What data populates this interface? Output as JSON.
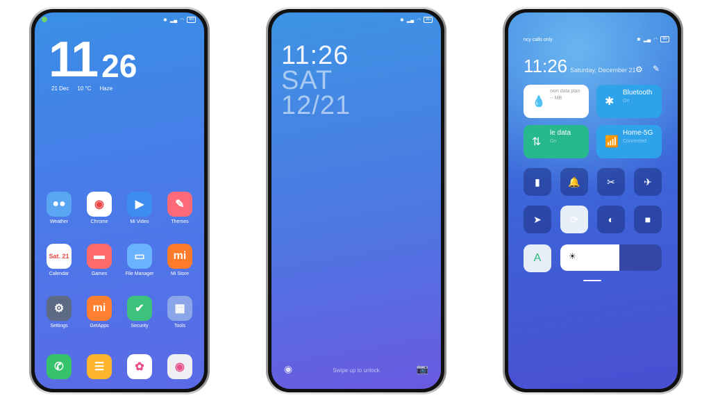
{
  "status": {
    "battery": "80"
  },
  "home": {
    "hour": "11",
    "minute": "26",
    "date": "21 Dec",
    "temp": "10 °C",
    "weather": "Haze",
    "apps": [
      [
        {
          "label": "Weather",
          "glyph": "●●",
          "bg": "#5aa6f3"
        },
        {
          "label": "Chrome",
          "glyph": "◉",
          "bg": "#ffffff"
        },
        {
          "label": "Mi Video",
          "glyph": "▶",
          "bg": "#3d8cf0"
        },
        {
          "label": "Themes",
          "glyph": "✎",
          "bg": "#ff6a7a"
        }
      ],
      [
        {
          "label": "Calendar",
          "glyph": "Sat. 21",
          "bg": "#ffffff"
        },
        {
          "label": "Games",
          "glyph": "▬",
          "bg": "#ff6b6b"
        },
        {
          "label": "File Manager",
          "glyph": "▭",
          "bg": "#6ab3ff"
        },
        {
          "label": "Mi Store",
          "glyph": "mi",
          "bg": "#ff7a2a"
        }
      ],
      [
        {
          "label": "Settings",
          "glyph": "⚙",
          "bg": "#5c6a84"
        },
        {
          "label": "GetApps",
          "glyph": "mi",
          "bg": "#ff7f30"
        },
        {
          "label": "Security",
          "glyph": "✔",
          "bg": "#3cc27a"
        },
        {
          "label": "Tools",
          "glyph": "▦",
          "bg": "#8aa6e8"
        }
      ]
    ],
    "dock": [
      {
        "name": "phone",
        "glyph": "✆",
        "bg": "#35c26a"
      },
      {
        "name": "messages",
        "glyph": "☰",
        "bg": "#ffb62e"
      },
      {
        "name": "gallery",
        "glyph": "✿",
        "bg": "#ffffff"
      },
      {
        "name": "camera",
        "glyph": "◉",
        "bg": "#eef0f4"
      }
    ]
  },
  "lock": {
    "time": "11:26",
    "day": "SAT",
    "date": "12/21",
    "swipe": "Swipe up to unlock"
  },
  "control": {
    "carrier": "ncy calls only",
    "time": "11:26",
    "date": "Saturday, December 21",
    "tiles": [
      {
        "title": "own data plan",
        "sub": "-- MB",
        "icon": "💧"
      },
      {
        "title": "Bluetooth",
        "sub": "On",
        "icon": "✱"
      },
      {
        "title": "le data",
        "sub": "On",
        "icon": "⇅"
      },
      {
        "title": "Home-5G",
        "sub": "Connected",
        "icon": "📶"
      }
    ],
    "toggles": [
      {
        "name": "flashlight",
        "glyph": "▮"
      },
      {
        "name": "mute",
        "glyph": "🔔"
      },
      {
        "name": "screenshot",
        "glyph": "✂"
      },
      {
        "name": "airplane",
        "glyph": "✈"
      },
      {
        "name": "location",
        "glyph": "➤"
      },
      {
        "name": "rotation-lock",
        "glyph": "⟳"
      },
      {
        "name": "reading-mode",
        "glyph": "◐"
      },
      {
        "name": "screen-recorder",
        "glyph": "■"
      }
    ],
    "auto_brightness": "A",
    "brightness": 0.58
  }
}
